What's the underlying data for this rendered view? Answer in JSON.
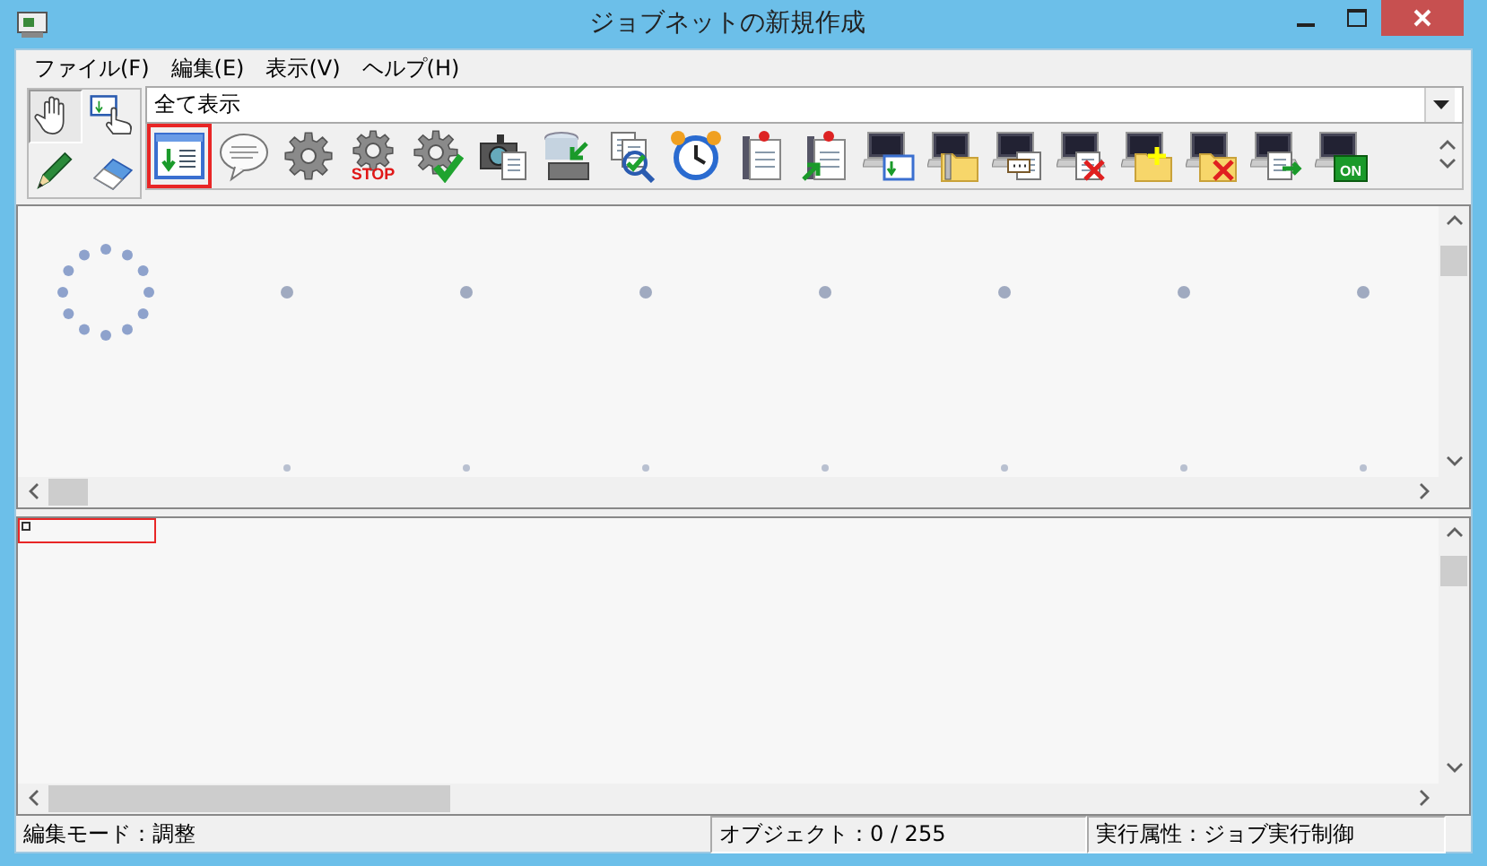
{
  "window": {
    "title": "ジョブネットの新規作成"
  },
  "menu": [
    {
      "label": "ファイル(F)"
    },
    {
      "label": "編集(E)"
    },
    {
      "label": "表示(V)"
    },
    {
      "label": "ヘルプ(H)"
    }
  ],
  "tools": [
    {
      "kind": "hand",
      "selected": true
    },
    {
      "kind": "pointer",
      "selected": false
    },
    {
      "kind": "pencil",
      "selected": false
    },
    {
      "kind": "eraser",
      "selected": false
    }
  ],
  "filter": {
    "value": "全て表示"
  },
  "toolbar": [
    {
      "kind": "job",
      "selected": true
    },
    {
      "kind": "message",
      "selected": false
    },
    {
      "kind": "gear",
      "selected": false
    },
    {
      "kind": "gear-stop",
      "selected": false,
      "label": "STOP"
    },
    {
      "kind": "gear-check",
      "selected": false
    },
    {
      "kind": "camera",
      "selected": false
    },
    {
      "kind": "database",
      "selected": false
    },
    {
      "kind": "doc-search",
      "selected": false
    },
    {
      "kind": "clock",
      "selected": false
    },
    {
      "kind": "pin-doc",
      "selected": false
    },
    {
      "kind": "pin-doc-arrow",
      "selected": false
    },
    {
      "kind": "pc-window",
      "selected": false
    },
    {
      "kind": "pc-zip",
      "selected": false
    },
    {
      "kind": "pc-chat",
      "selected": false
    },
    {
      "kind": "pc-doc-x",
      "selected": false
    },
    {
      "kind": "pc-folder-new",
      "selected": false
    },
    {
      "kind": "pc-folder-x",
      "selected": false
    },
    {
      "kind": "pc-doc-arrow",
      "selected": false
    },
    {
      "kind": "pc-on",
      "selected": false,
      "label": "ON"
    }
  ],
  "status_bar": [
    {
      "text": "編集モード：調整"
    },
    {
      "text": "オブジェクト：0 / 255"
    },
    {
      "text": "実行属性：ジョブ実行制御"
    }
  ]
}
